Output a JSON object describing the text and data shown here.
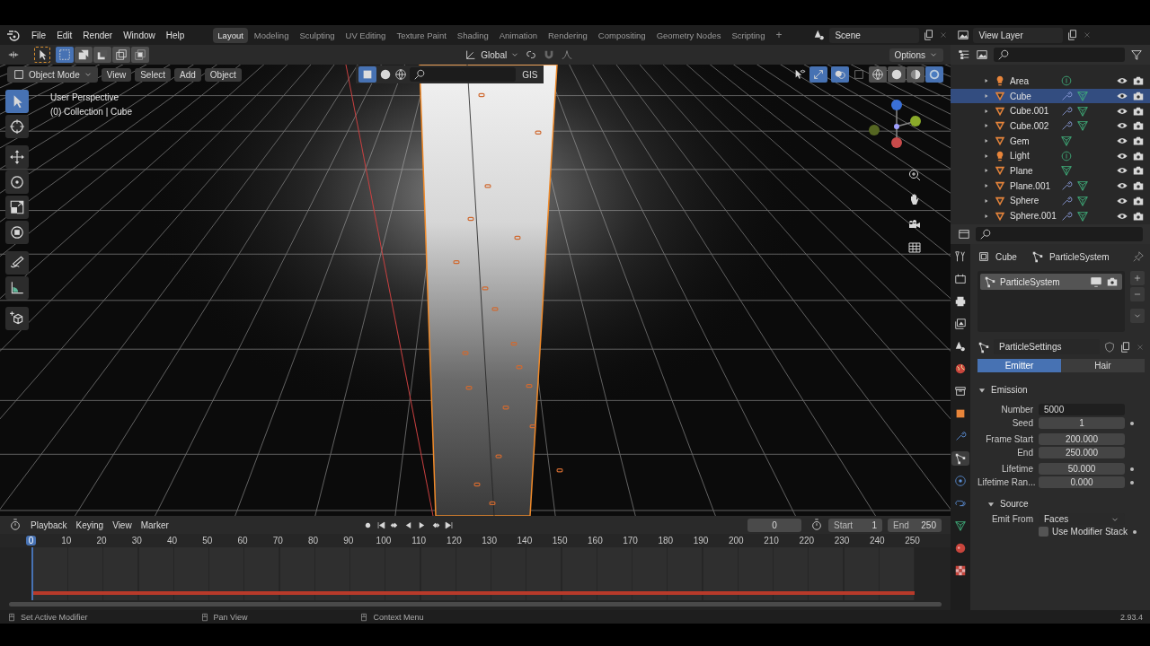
{
  "menu": [
    "File",
    "Edit",
    "Render",
    "Window",
    "Help"
  ],
  "workspaces": [
    {
      "label": "Layout",
      "selected": true
    },
    {
      "label": "Modeling",
      "selected": false
    },
    {
      "label": "Sculpting",
      "selected": false
    },
    {
      "label": "UV Editing",
      "selected": false
    },
    {
      "label": "Texture Paint",
      "selected": false
    },
    {
      "label": "Shading",
      "selected": false
    },
    {
      "label": "Animation",
      "selected": false
    },
    {
      "label": "Rendering",
      "selected": false
    },
    {
      "label": "Compositing",
      "selected": false
    },
    {
      "label": "Geometry Nodes",
      "selected": false
    },
    {
      "label": "Scripting",
      "selected": false
    }
  ],
  "add_workspace": "+",
  "scene": "Scene",
  "view_layer": "View Layer",
  "tool_header": {
    "select_modes": [
      {
        "kind": "set",
        "selected": true
      },
      {
        "kind": "extend",
        "selected": false
      },
      {
        "kind": "subtract",
        "selected": false
      },
      {
        "kind": "invert",
        "selected": false
      },
      {
        "kind": "intersect",
        "selected": false
      }
    ],
    "orientation": "Global",
    "options": "Options"
  },
  "viewport_header": {
    "mode": "Object Mode",
    "menus": [
      "View",
      "Select",
      "Add",
      "Object"
    ],
    "search_label": "GIS",
    "shading": [
      {
        "kind": "wireframe",
        "selected": false
      },
      {
        "kind": "solid",
        "selected": false
      },
      {
        "kind": "material",
        "selected": false
      },
      {
        "kind": "rendered",
        "selected": true
      }
    ]
  },
  "viewport": {
    "view_name": "User Perspective",
    "context": "(0) Collection | Cube"
  },
  "toolbar": [
    {
      "kind": "select",
      "selected": true
    },
    {
      "kind": "cursor",
      "selected": false
    },
    {
      "kind": "move",
      "selected": false
    },
    {
      "kind": "rotate",
      "selected": false
    },
    {
      "kind": "scale",
      "selected": false
    },
    {
      "kind": "transform",
      "selected": false
    },
    {
      "kind": "annotate",
      "selected": false
    },
    {
      "kind": "measure",
      "selected": false
    },
    {
      "kind": "add-cube",
      "selected": false
    }
  ],
  "outliner": [
    {
      "name": "Area",
      "kind": "light",
      "modifiers": false,
      "selected": false
    },
    {
      "name": "Cube",
      "kind": "mesh",
      "modifiers": true,
      "selected": true
    },
    {
      "name": "Cube.001",
      "kind": "mesh",
      "modifiers": true,
      "selected": false
    },
    {
      "name": "Cube.002",
      "kind": "mesh",
      "modifiers": true,
      "selected": false
    },
    {
      "name": "Gem",
      "kind": "mesh",
      "modifiers": false,
      "selected": false
    },
    {
      "name": "Light",
      "kind": "light",
      "modifiers": false,
      "selected": false
    },
    {
      "name": "Plane",
      "kind": "mesh",
      "modifiers": false,
      "selected": false
    },
    {
      "name": "Plane.001",
      "kind": "mesh",
      "modifiers": true,
      "selected": false
    },
    {
      "name": "Sphere",
      "kind": "mesh",
      "modifiers": true,
      "selected": false
    },
    {
      "name": "Sphere.001",
      "kind": "mesh",
      "modifiers": true,
      "selected": false
    }
  ],
  "property_tabs": [
    {
      "kind": "tool",
      "selected": false
    },
    {
      "kind": "render",
      "selected": false
    },
    {
      "kind": "output",
      "selected": false
    },
    {
      "kind": "view-layer",
      "selected": false
    },
    {
      "kind": "scene",
      "selected": false
    },
    {
      "kind": "world",
      "selected": false
    },
    {
      "kind": "collection",
      "selected": false
    },
    {
      "kind": "object",
      "selected": false
    },
    {
      "kind": "modifier",
      "selected": false
    },
    {
      "kind": "particles",
      "selected": true
    },
    {
      "kind": "physics",
      "selected": false
    },
    {
      "kind": "constraints",
      "selected": false
    },
    {
      "kind": "data",
      "selected": false
    },
    {
      "kind": "material",
      "selected": false
    },
    {
      "kind": "texture",
      "selected": false
    }
  ],
  "properties": {
    "object": "Cube",
    "system": "ParticleSystem",
    "systems": [
      {
        "name": "ParticleSystem",
        "selected": true
      }
    ],
    "settings": "ParticleSettings",
    "types": [
      {
        "label": "Emitter",
        "selected": true
      },
      {
        "label": "Hair",
        "selected": false
      }
    ],
    "emission": {
      "title": "Emission",
      "expanded": true,
      "fields": [
        {
          "label": "Number",
          "value": "5000",
          "editing": true,
          "animatable": false
        },
        {
          "label": "Seed",
          "value": "1",
          "editing": false,
          "animatable": true
        },
        {
          "label": "Frame Start",
          "value": "200.000",
          "editing": false,
          "animatable": false
        },
        {
          "label": "End",
          "value": "250.000",
          "editing": false,
          "animatable": false
        },
        {
          "label": "Lifetime",
          "value": "50.000",
          "editing": false,
          "animatable": true
        },
        {
          "label": "Lifetime Ran...",
          "value": "0.000",
          "editing": false,
          "animatable": true
        }
      ]
    },
    "source": {
      "title": "Source",
      "expanded": true,
      "emit_from_label": "Emit From",
      "emit_from": "Faces",
      "modifier_stack": {
        "label": "Use Modifier Stack",
        "checked": false
      }
    }
  },
  "timeline": {
    "menus": [
      "Playback",
      "Keying",
      "View",
      "Marker"
    ],
    "current_frame": "0",
    "start_label": "Start",
    "start": "1",
    "end_label": "End",
    "end": "250",
    "ticks": [
      {
        "label": "0",
        "selected": true
      },
      {
        "label": "10",
        "selected": false
      },
      {
        "label": "20",
        "selected": false
      },
      {
        "label": "30",
        "selected": false
      },
      {
        "label": "40",
        "selected": false
      },
      {
        "label": "50",
        "selected": false
      },
      {
        "label": "60",
        "selected": false
      },
      {
        "label": "70",
        "selected": false
      },
      {
        "label": "80",
        "selected": false
      },
      {
        "label": "90",
        "selected": false
      },
      {
        "label": "100",
        "selected": false
      },
      {
        "label": "110",
        "selected": false
      },
      {
        "label": "120",
        "selected": false
      },
      {
        "label": "130",
        "selected": false
      },
      {
        "label": "140",
        "selected": false
      },
      {
        "label": "150",
        "selected": false
      },
      {
        "label": "160",
        "selected": false
      },
      {
        "label": "170",
        "selected": false
      },
      {
        "label": "180",
        "selected": false
      },
      {
        "label": "190",
        "selected": false
      },
      {
        "label": "200",
        "selected": false
      },
      {
        "label": "210",
        "selected": false
      },
      {
        "label": "220",
        "selected": false
      },
      {
        "label": "230",
        "selected": false
      },
      {
        "label": "240",
        "selected": false
      },
      {
        "label": "250",
        "selected": false
      }
    ]
  },
  "status_bar": {
    "hints": [
      "Set Active Modifier",
      "Pan View",
      "Context Menu"
    ],
    "version": "2.93.4"
  }
}
